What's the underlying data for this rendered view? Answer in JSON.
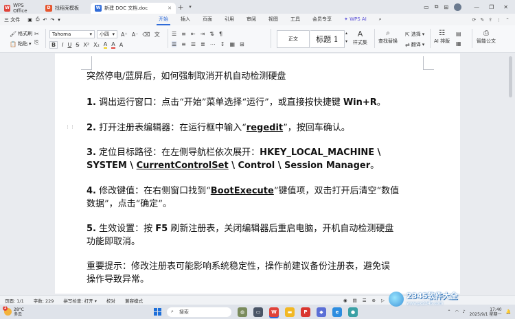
{
  "titlebar": {
    "tabs": [
      {
        "label": "WPS Office"
      },
      {
        "label": "找稻壳模板"
      },
      {
        "label": "新建 DOC 文档.doc"
      }
    ]
  },
  "menubar": {
    "file_label": "三 文件",
    "items": [
      "开始",
      "插入",
      "页面",
      "引用",
      "审阅",
      "视图",
      "工具",
      "会员专享",
      "WPS AI"
    ],
    "active": "开始"
  },
  "ribbon": {
    "format_painter": "格式刷",
    "paste": "粘贴",
    "font_name": "Tahoma",
    "font_size": "小四",
    "style_normal": "正文",
    "style_heading1": "标题 1",
    "styles_set": "样式集",
    "find_replace": "查找替换",
    "select": "选择",
    "translate": "翻译",
    "ai_layout": "AI 排版",
    "smart_doc": "智能公文"
  },
  "document": {
    "title": "突然停电/蓝屏后，如何强制取消开机自动检测硬盘",
    "steps": [
      {
        "num": "1.",
        "text": "调出运行窗口：点击“开始”菜单选择“运行”，或直接按快捷键 ",
        "key": "Win+R",
        "tail": "。"
      },
      {
        "num": "2.",
        "text": "打开注册表编辑器：在运行框中输入“",
        "key": "regedit",
        "tail": "”，按回车确认。"
      },
      {
        "num": "3.",
        "text": "定位目标路径：在左侧导航栏依次展开：",
        "path1": "HKEY_LOCAL_MACHINE \\",
        "path2a": "SYSTEM \\ ",
        "path2b": "CurrentControlSet",
        "path2c": " \\ Control \\ Session Manager",
        "tail": "。"
      },
      {
        "num": "4.",
        "text": "修改键值：在右侧窗口找到“",
        "key": "BootExecute",
        "tail": "”键值项，双击打开后清空“数值",
        "line2": "数据”，点击“确定”。"
      },
      {
        "num": "5.",
        "text": "生效设置：按 ",
        "key": "F5",
        "tail": " 刷新注册表，关闭编辑器后重启电脑，开机自动检测硬盘",
        "line2": "功能即取消。"
      }
    ],
    "notice_line1": "重要提示：修改注册表可能影响系统稳定性，操作前建议备份注册表，避免误",
    "notice_line2": "操作导致异常。"
  },
  "statusbar": {
    "page": "页面: 1/1",
    "words": "字数: 229",
    "spell": "拼写检查: 打开 ▾",
    "proofread": "校对",
    "compat": "兼容模式"
  },
  "taskbar": {
    "weather_temp": "28°C",
    "weather_desc": "多云",
    "weather_badge": "1",
    "search_placeholder": "搜索",
    "time": "17:40",
    "date": "2025/9/1 星期一"
  },
  "watermark": {
    "brand": "2345软件大全",
    "url": "www.pc2345.com"
  },
  "colors": {
    "accent": "#2f6bd8",
    "wps_red": "#e0433a"
  }
}
